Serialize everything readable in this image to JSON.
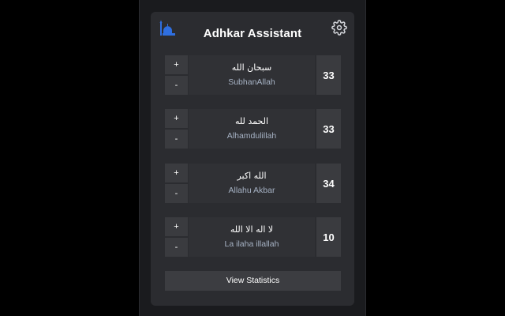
{
  "header": {
    "title": "Adhkar Assistant",
    "logo_icon": "mosque-icon",
    "settings_icon": "gear-icon"
  },
  "colors": {
    "background": "#000000",
    "window": "#1a1b1e",
    "panel": "#2b2c30",
    "button": "#3a3b3f",
    "accent_logo": "#2f6fe0",
    "transliteration": "#a6b2c4"
  },
  "dhikr": [
    {
      "arabic": "سبحان الله",
      "latin": "SubhanAllah",
      "count": "33",
      "plus": "+",
      "minus": "-"
    },
    {
      "arabic": "الحمد لله",
      "latin": "Alhamdulillah",
      "count": "33",
      "plus": "+",
      "minus": "-"
    },
    {
      "arabic": "الله اكبر",
      "latin": "Allahu Akbar",
      "count": "34",
      "plus": "+",
      "minus": "-"
    },
    {
      "arabic": "لا اله الا الله",
      "latin": "La ilaha illallah",
      "count": "10",
      "plus": "+",
      "minus": "-"
    }
  ],
  "footer": {
    "stats_label": "View Statistics"
  }
}
